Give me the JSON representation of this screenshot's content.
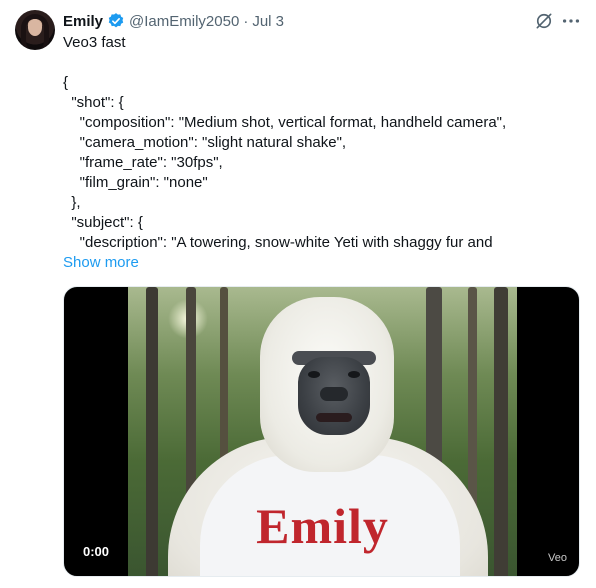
{
  "author": {
    "name": "Emily",
    "handle": "@IamEmily2050",
    "separator": "·",
    "date": "Jul 3"
  },
  "tweet": {
    "lines": [
      "Veo3 fast",
      "",
      "{",
      "  \"shot\": {",
      "    \"composition\": \"Medium shot, vertical format, handheld camera\",",
      "    \"camera_motion\": \"slight natural shake\",",
      "    \"frame_rate\": \"30fps\",",
      "    \"film_grain\": \"none\"",
      "  },",
      "  \"subject\": {",
      "    \"description\": \"A towering, snow-white Yeti with shaggy fur and"
    ],
    "show_more_label": "Show more"
  },
  "media": {
    "shirt_text": "Emily",
    "timestamp": "0:00",
    "watermark": "Veo"
  },
  "icons": {
    "verified": "verified-badge-icon",
    "grok": "grok-icon",
    "more": "more-icon"
  },
  "colors": {
    "link": "#1d9bf0",
    "secondary_text": "#536471",
    "verified": "#1d9bf0",
    "shirt_text": "#c0262d"
  }
}
